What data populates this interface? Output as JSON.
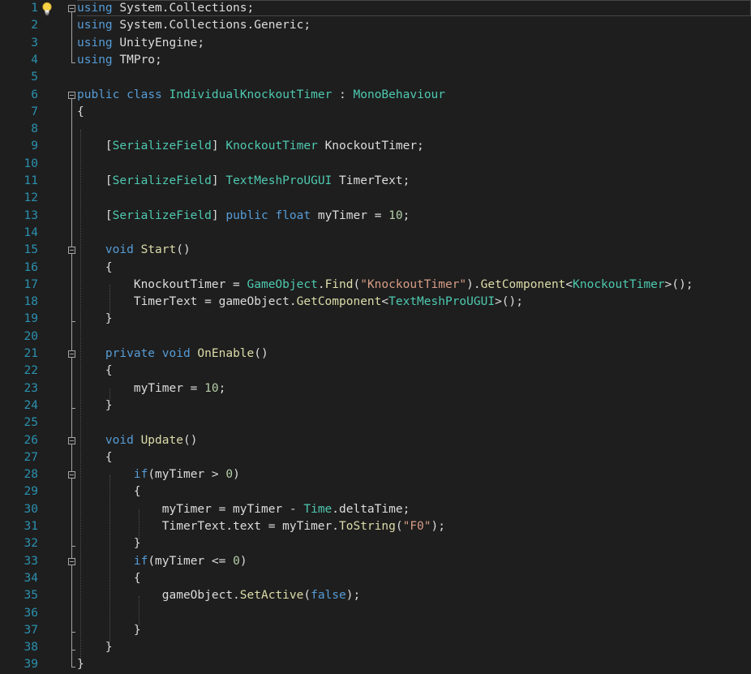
{
  "colors": {
    "background": "#1e1e1e",
    "line_number": "#2b91af",
    "keyword": "#569cd6",
    "type": "#4ec9b0",
    "string": "#d69d85",
    "number": "#b5cea8",
    "method": "#dcdcaa",
    "plain": "#dcdcdc"
  },
  "icons": {
    "lightbulb": "lightbulb-icon",
    "fold": "collapse-minus-icon"
  },
  "lines": [
    [
      [
        "k",
        "using"
      ],
      [
        "p",
        " System.Collections;"
      ]
    ],
    [
      [
        "k",
        "using"
      ],
      [
        "p",
        " System.Collections.Generic;"
      ]
    ],
    [
      [
        "k",
        "using"
      ],
      [
        "p",
        " UnityEngine;"
      ]
    ],
    [
      [
        "k",
        "using"
      ],
      [
        "p",
        " TMPro;"
      ]
    ],
    [],
    [
      [
        "k",
        "public"
      ],
      [
        "p",
        " "
      ],
      [
        "k",
        "class"
      ],
      [
        "p",
        " "
      ],
      [
        "t",
        "IndividualKnockoutTimer"
      ],
      [
        "p",
        " : "
      ],
      [
        "t",
        "MonoBehaviour"
      ]
    ],
    [
      [
        "p",
        "{"
      ]
    ],
    [],
    [
      [
        "p",
        "    ["
      ],
      [
        "t",
        "SerializeField"
      ],
      [
        "p",
        "] "
      ],
      [
        "t",
        "KnockoutTimer"
      ],
      [
        "p",
        " KnockoutTimer;"
      ]
    ],
    [],
    [
      [
        "p",
        "    ["
      ],
      [
        "t",
        "SerializeField"
      ],
      [
        "p",
        "] "
      ],
      [
        "t",
        "TextMeshProUGUI"
      ],
      [
        "p",
        " TimerText;"
      ]
    ],
    [],
    [
      [
        "p",
        "    ["
      ],
      [
        "t",
        "SerializeField"
      ],
      [
        "p",
        "] "
      ],
      [
        "k",
        "public"
      ],
      [
        "p",
        " "
      ],
      [
        "k",
        "float"
      ],
      [
        "p",
        " myTimer = "
      ],
      [
        "n",
        "10"
      ],
      [
        "p",
        ";"
      ]
    ],
    [],
    [
      [
        "p",
        "    "
      ],
      [
        "k",
        "void"
      ],
      [
        "p",
        " "
      ],
      [
        "m",
        "Start"
      ],
      [
        "p",
        "()"
      ]
    ],
    [
      [
        "p",
        "    {"
      ]
    ],
    [
      [
        "p",
        "        KnockoutTimer = "
      ],
      [
        "t",
        "GameObject"
      ],
      [
        "p",
        "."
      ],
      [
        "m",
        "Find"
      ],
      [
        "p",
        "("
      ],
      [
        "s",
        "\"KnockoutTimer\""
      ],
      [
        "p",
        ")."
      ],
      [
        "m",
        "GetComponent"
      ],
      [
        "p",
        "<"
      ],
      [
        "t",
        "KnockoutTimer"
      ],
      [
        "p",
        ">();"
      ]
    ],
    [
      [
        "p",
        "        TimerText = gameObject."
      ],
      [
        "m",
        "GetComponent"
      ],
      [
        "p",
        "<"
      ],
      [
        "t",
        "TextMeshProUGUI"
      ],
      [
        "p",
        ">();"
      ]
    ],
    [
      [
        "p",
        "    }"
      ]
    ],
    [],
    [
      [
        "p",
        "    "
      ],
      [
        "k",
        "private"
      ],
      [
        "p",
        " "
      ],
      [
        "k",
        "void"
      ],
      [
        "p",
        " "
      ],
      [
        "m",
        "OnEnable"
      ],
      [
        "p",
        "()"
      ]
    ],
    [
      [
        "p",
        "    {"
      ]
    ],
    [
      [
        "p",
        "        myTimer = "
      ],
      [
        "n",
        "10"
      ],
      [
        "p",
        ";"
      ]
    ],
    [
      [
        "p",
        "    }"
      ]
    ],
    [],
    [
      [
        "p",
        "    "
      ],
      [
        "k",
        "void"
      ],
      [
        "p",
        " "
      ],
      [
        "m",
        "Update"
      ],
      [
        "p",
        "()"
      ]
    ],
    [
      [
        "p",
        "    {"
      ]
    ],
    [
      [
        "p",
        "        "
      ],
      [
        "k",
        "if"
      ],
      [
        "p",
        "(myTimer > "
      ],
      [
        "n",
        "0"
      ],
      [
        "p",
        ")"
      ]
    ],
    [
      [
        "p",
        "        {"
      ]
    ],
    [
      [
        "p",
        "            myTimer = myTimer - "
      ],
      [
        "t",
        "Time"
      ],
      [
        "p",
        ".deltaTime;"
      ]
    ],
    [
      [
        "p",
        "            TimerText.text = myTimer."
      ],
      [
        "m",
        "ToString"
      ],
      [
        "p",
        "("
      ],
      [
        "s",
        "\"F0\""
      ],
      [
        "p",
        ");"
      ]
    ],
    [
      [
        "p",
        "        }"
      ]
    ],
    [
      [
        "p",
        "        "
      ],
      [
        "k",
        "if"
      ],
      [
        "p",
        "(myTimer <= "
      ],
      [
        "n",
        "0"
      ],
      [
        "p",
        ")"
      ]
    ],
    [
      [
        "p",
        "        {"
      ]
    ],
    [
      [
        "p",
        "            gameObject."
      ],
      [
        "m",
        "SetActive"
      ],
      [
        "p",
        "("
      ],
      [
        "k",
        "false"
      ],
      [
        "p",
        ");"
      ]
    ],
    [],
    [
      [
        "p",
        "        }"
      ]
    ],
    [
      [
        "p",
        "    }"
      ]
    ],
    [
      [
        "p",
        "}"
      ]
    ]
  ]
}
